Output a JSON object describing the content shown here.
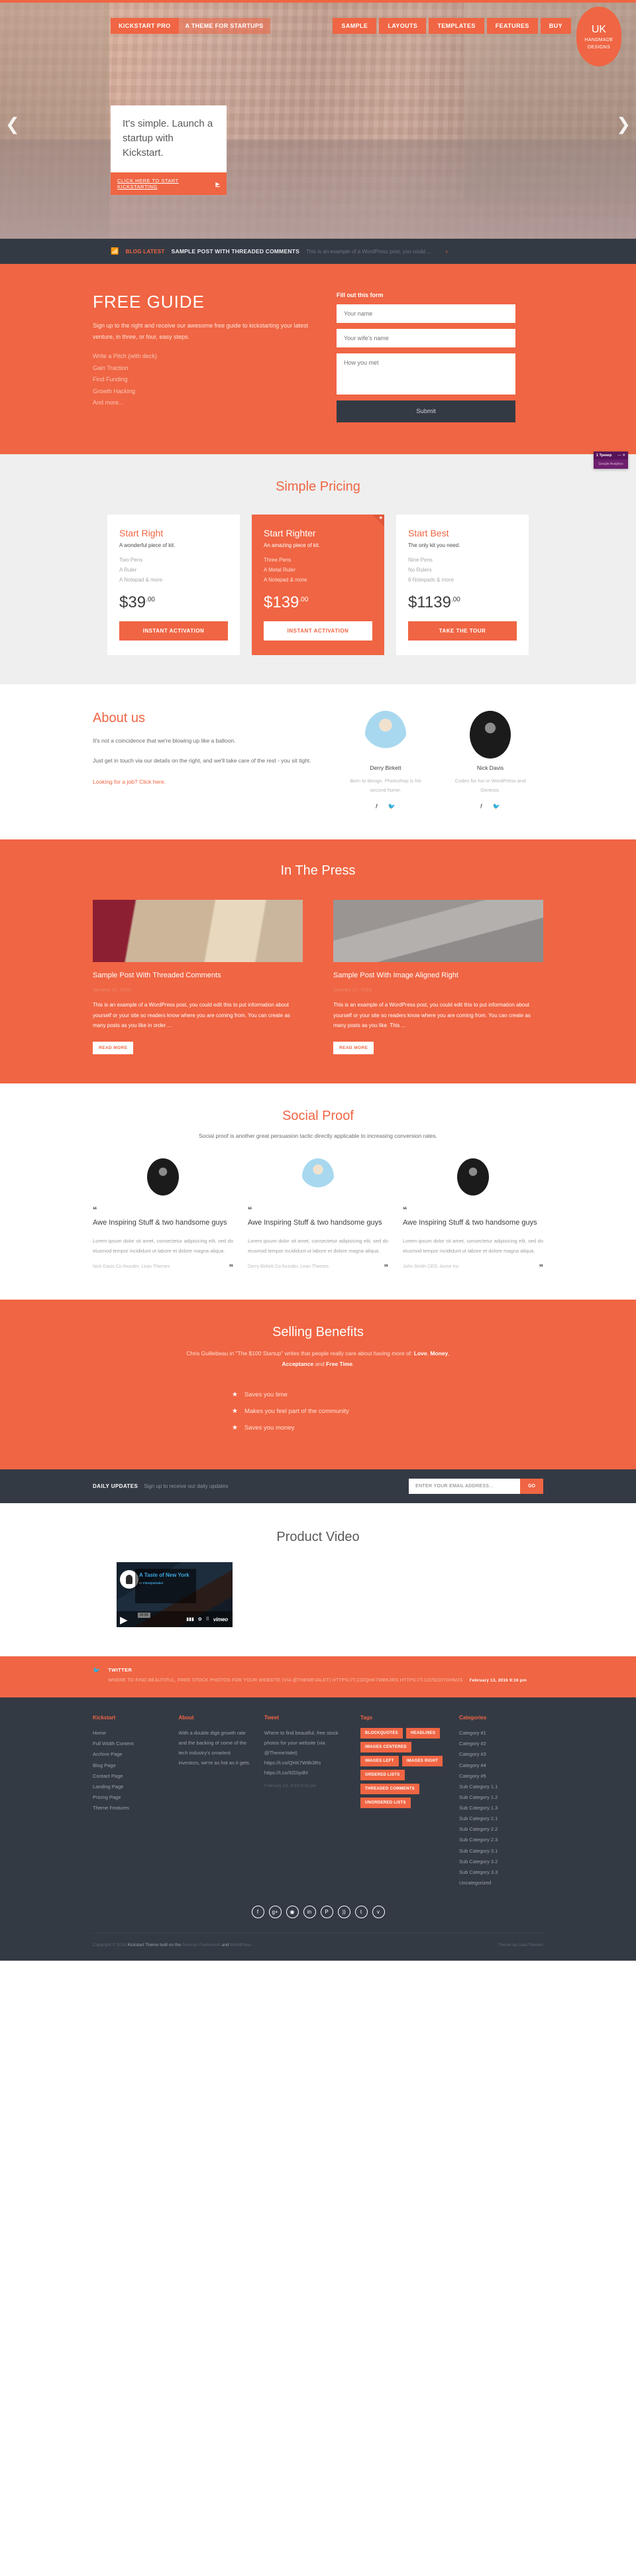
{
  "hero": {
    "brand": "KICKSTART PRO",
    "tagline": "A THEME FOR STARTUPS",
    "menu": [
      "SAMPLE",
      "LAYOUTS",
      "TEMPLATES",
      "FEATURES",
      "BUY"
    ],
    "badge": {
      "line1": "UK",
      "line2": "HANDMADE",
      "line3": "DESIGNS"
    },
    "prev_icon": "chevron-left",
    "next_icon": "chevron-right",
    "slide_heading": "It's simple. Launch a startup with Kickstart.",
    "cta_label": "CLICK HERE TO START KICKSTARTING",
    "cta_arrow": "▶"
  },
  "ticker": {
    "rss_icon": "rss",
    "label": "BLOG LATEST",
    "title": "SAMPLE POST WITH THREADED COMMENTS",
    "excerpt": "This is an example of a WordPress post, you could ...",
    "next_arrow": "›"
  },
  "guide": {
    "heading": "FREE GUIDE",
    "paragraph": "Sign up to the right and receive our awesome free guide to kickstarting your latest venture, in three, or four, easy steps.",
    "items": [
      "Write a Pitch (with deck)",
      "Gain Traction",
      "Find Funding",
      "Growth Hacking",
      "And more..."
    ],
    "form_label": "Fill out this form",
    "name_placeholder": "Your name",
    "wife_placeholder": "Your wife's name",
    "met_placeholder": "How you met",
    "submit_label": "Submit"
  },
  "tracker": {
    "title": "1 Трекер",
    "minimize_icon": "—",
    "close_icon": "✕",
    "item": "Google Analytics"
  },
  "pricing": {
    "heading": "Simple Pricing",
    "plans": [
      {
        "name": "Start Right",
        "sub": "A wonderful piece of kit.",
        "features": [
          "Two Pens",
          "A Ruler",
          "A Notepad & more"
        ],
        "price": "$39",
        "cents": ".00",
        "cta": "INSTANT ACTIVATION",
        "featured": false
      },
      {
        "name": "Start Righter",
        "sub": "An amazing piece of kit.",
        "features": [
          "Three Pens",
          "A Metal Ruler",
          "A Notepad & more"
        ],
        "price": "$139",
        "cents": ".00",
        "cta": "INSTANT ACTIVATION",
        "featured": true
      },
      {
        "name": "Start Best",
        "sub": "The only kit you need.",
        "features": [
          "Nine Pens",
          "No Rulers",
          "6 Notepads & more"
        ],
        "price": "$1139",
        "cents": ".00",
        "cta": "TAKE THE TOUR",
        "featured": false
      }
    ]
  },
  "about": {
    "heading": "About us",
    "p1": "It's not a coincidence that we're blowing up like a balloon.",
    "p2": "Just get in touch via our details on the right, and we'll take care of the rest - you sit tight.",
    "job_link": "Looking for a job? Click here.",
    "people": [
      {
        "name": "Derry Birkett",
        "bio": "Born to design. Photoshop is his second home.",
        "facebook": "f",
        "twitter": "t"
      },
      {
        "name": "Nick Davis",
        "bio": "Codes for fun in WordPress and Genesis.",
        "facebook": "f",
        "twitter": "t"
      }
    ]
  },
  "press": {
    "heading": "In The Press",
    "posts": [
      {
        "title": "Sample Post With Threaded Comments",
        "date": "January 21, 2016",
        "excerpt": "This is an example of a WordPress post, you could edit this to put information about yourself or your site so readers know where you are coming from. You can create as many posts as you like in order ...",
        "read_more": "READ MORE"
      },
      {
        "title": "Sample Post With Image Aligned Right",
        "date": "January 17, 2016",
        "excerpt": "This is an example of a WordPress post, you could edit this to put information about yourself or your site so readers know where you are coming from. You can create as many posts as you like. This ...",
        "read_more": "READ MORE"
      }
    ]
  },
  "proof": {
    "heading": "Social Proof",
    "lead": "Social proof is another great persuasion tactic directly applicable to increasing conversion rates.",
    "open_quote": "“",
    "close_quote": "”",
    "testimonials": [
      {
        "title": "Awe Inspiring Stuff & two handsome guys",
        "body": "Lorem ipsum dolor sit amet, consectetur adipisicing elit, sed do eiusmod tempor incididunt ut labore et dolore magna aliqua.",
        "cite": "Nick Davis Co-founder, Lean Themes"
      },
      {
        "title": "Awe Inspiring Stuff & two handsome guys",
        "body": "Lorem ipsum dolor sit amet, consectetur adipisicing elit, sed do eiusmod tempor incididunt ut labore et dolore magna aliqua.",
        "cite": "Derry Birkett Co-founder, Lean Themes"
      },
      {
        "title": "Awe Inspiring Stuff & two handsome guys",
        "body": "Lorem ipsum dolor sit amet, consectetur adipisicing elit, sed do eiusmod tempor incididunt ut labore et dolore magna aliqua.",
        "cite": "John Smith CEO, Acme Inc"
      }
    ]
  },
  "benefits": {
    "heading": "Selling Benefits",
    "lead_part1": "Chris Guillebeau in \"The $100 Startup\" writes that people really care about having more of: ",
    "b1": "Love",
    "sep1": ", ",
    "b2": "Money",
    "sep2": ", ",
    "b3": "Acceptance",
    "sep3": " and ",
    "b4": "Free Time",
    "lead_end": ".",
    "star_icon": "★",
    "items": [
      "Saves you time",
      "Makes you feel part of the community",
      "Saves you money"
    ]
  },
  "signup": {
    "title": "DAILY UPDATES",
    "subtitle": "Sign up to receive our daily updates",
    "placeholder": "ENTER YOUR EMAIL ADDRESS...",
    "button": "GO"
  },
  "video": {
    "heading": "Product Video",
    "video_title": "A Taste of New York",
    "by_prefix": "от ",
    "channel": "FilmSpektakel",
    "duration": "02:59",
    "play_icon": "▶",
    "quality_icon": "▮▮▮",
    "settings_icon": "✿",
    "fullscreen_icon": "⠿",
    "brand": "vimeo"
  },
  "twitter_strip": {
    "icon": "twitter-bird",
    "label": "TWITTER",
    "body": "WHERE TO FIND BEAUTIFUL, FREE STOCK PHOTOS FOR YOUR WEBSITE (VIA @THEMEVALET) HTTPS://T.CO/QHK7WBK3RS HTTPS://T.CO/92DIYDHMJS",
    "time": "February 13, 2016 9:16 pm"
  },
  "footer": {
    "col1": {
      "title": "Kickstart",
      "links": [
        "Home",
        "Full Width Content",
        "Archive Page",
        "Blog Page",
        "Contact Page",
        "Landing Page",
        "Pricing Page",
        "Theme Features"
      ]
    },
    "col2": {
      "title": "About",
      "text": "With a double digit growth rate and the backing of some of the tech industry's smartest investors, we're as hot as it gets."
    },
    "col3": {
      "title": "Tweet",
      "text": "Where to find beautiful, free stock photos for your website (via @ThemeValet) https://t.co/QHK7W8k3Rs https://t.co/92Diydhl",
      "time": "February 13, 2016 9:16 pm"
    },
    "col4": {
      "title": "Tags",
      "tags": [
        "BLOCKQUOTES",
        "HEADLINES",
        "IMAGES CENTERED",
        "IMAGES LEFT",
        "IMAGES RIGHT",
        "ORDERED LISTS",
        "THREADED COMMENTS",
        "UNORDERED LISTS"
      ]
    },
    "col5": {
      "title": "Categories",
      "links": [
        "Category #1",
        "Category #2",
        "Category #3",
        "Category #4",
        "Category #5",
        "Sub Category 1.1",
        "Sub Category 1.2",
        "Sub Category 1.3",
        "Sub Category 2.1",
        "Sub Category 2.2",
        "Sub Category 2.3",
        "Sub Category 3.1",
        "Sub Category 3.2",
        "Sub Category 3.3",
        "Uncategorized"
      ]
    },
    "social": [
      "facebook",
      "google-plus",
      "instagram",
      "linkedin",
      "pinterest",
      "rss",
      "twitter",
      "vimeo"
    ],
    "social_glyphs": [
      "f",
      "g+",
      "◉",
      "in",
      "P",
      "))",
      "t",
      "v"
    ],
    "credits_left_a": "Copyright © 2016 ",
    "credits_left_b": "Kickstart Theme",
    "credits_left_c": " built on the ",
    "credits_left_d": "Genesis Framework",
    "credits_left_e": " and ",
    "credits_left_f": "WordPress",
    "credits_right_a": "Theme by ",
    "credits_right_b": "LeanThemes"
  },
  "colors": {
    "accent": "#f06543",
    "dark": "#343a44",
    "light_gray": "#efefef"
  }
}
